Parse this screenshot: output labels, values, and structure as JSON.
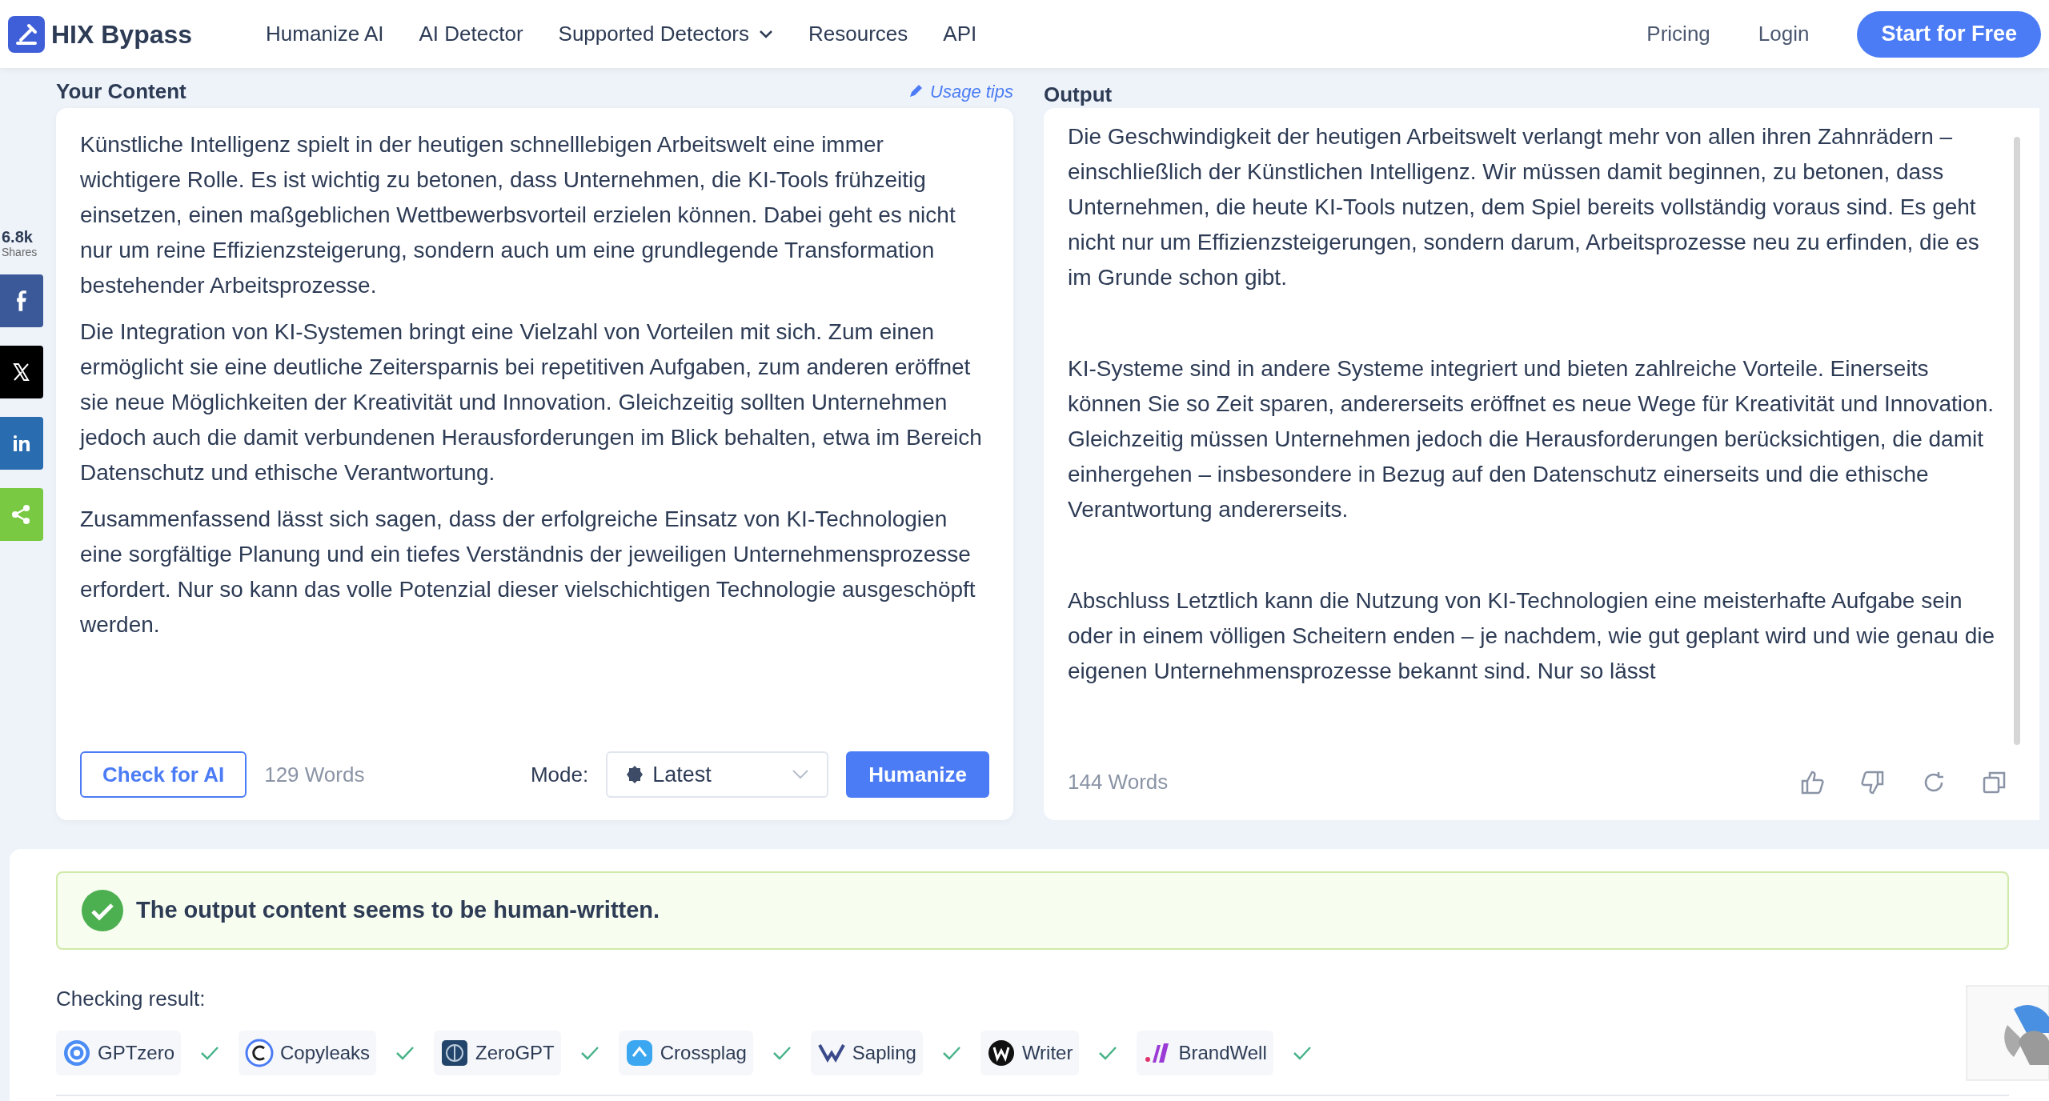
{
  "nav": {
    "logo": "HIX Bypass",
    "links": [
      {
        "label": "Humanize AI",
        "dropdown": false
      },
      {
        "label": "AI Detector",
        "dropdown": false
      },
      {
        "label": "Supported Detectors",
        "dropdown": true
      },
      {
        "label": "Resources",
        "dropdown": false
      },
      {
        "label": "API",
        "dropdown": false
      }
    ],
    "right_links": [
      "Pricing",
      "Login"
    ],
    "cta": "Start for Free"
  },
  "share": {
    "count": "6.8k",
    "label": "Shares",
    "buttons": [
      {
        "kind": "facebook",
        "color": "#3b5998"
      },
      {
        "kind": "x",
        "color": "#000000"
      },
      {
        "kind": "linkedin",
        "color": "#2a6cb0"
      },
      {
        "kind": "share",
        "color": "#7ac943"
      }
    ]
  },
  "input": {
    "title": "Your Content",
    "tips": "Usage tips",
    "paragraphs": [
      "Künstliche Intelligenz spielt in der heutigen schnelllebigen Arbeitswelt eine immer wichtigere Rolle. Es ist wichtig zu betonen, dass Unternehmen, die KI-Tools frühzeitig einsetzen, einen maßgeblichen Wettbewerbsvorteil erzielen können. Dabei geht es nicht nur um reine Effizienzsteigerung, sondern auch um eine grundlegende Transformation bestehender Arbeitsprozesse.",
      "Die Integration von KI-Systemen bringt eine Vielzahl von Vorteilen mit sich. Zum einen ermöglicht sie eine deutliche Zeitersparnis bei repetitiven Aufgaben, zum anderen eröffnet sie neue Möglichkeiten der Kreativität und Innovation. Gleichzeitig sollten Unternehmen jedoch auch die damit verbundenen Herausforderungen im Blick behalten, etwa im Bereich Datenschutz und ethische Verantwortung.",
      "Zusammenfassend lässt sich sagen, dass der erfolgreiche Einsatz von KI-Technologien eine sorgfältige Planung und ein tiefes Verständnis der jeweiligen Unternehmensprozesse erfordert. Nur so kann das volle Potenzial dieser vielschichtigen Technologie ausgeschöpft werden."
    ],
    "check_button": "Check for AI",
    "word_count": "129 Words",
    "mode_label": "Mode:",
    "mode_value": "Latest",
    "humanize_button": "Humanize"
  },
  "output": {
    "title": "Output",
    "paragraphs": [
      "Die Geschwindigkeit der heutigen Arbeitswelt verlangt mehr von allen ihren Zahnrädern – einschließlich der Künstlichen Intelligenz. Wir müssen damit beginnen, zu betonen, dass Unternehmen, die heute KI-Tools nutzen, dem Spiel bereits vollständig voraus sind. Es geht nicht nur um Effizienzsteigerungen, sondern darum, Arbeitsprozesse neu zu erfinden, die es im Grunde schon gibt.",
      "KI-Systeme sind in andere Systeme integriert und bieten zahlreiche Vorteile. Einerseits können Sie so Zeit sparen, andererseits eröffnet es neue Wege für Kreativität und Innovation. Gleichzeitig müssen Unternehmen jedoch die Herausforderungen berücksichtigen, die damit einhergehen – insbesondere in Bezug auf den Datenschutz einerseits und die ethische Verantwortung andererseits.",
      "Abschluss Letztlich kann die Nutzung von KI-Technologien eine meisterhafte Aufgabe sein oder in einem völligen Scheitern enden – je nachdem, wie gut geplant wird und wie genau die eigenen Unternehmensprozesse bekannt sind. Nur so lässt"
    ],
    "word_count": "144 Words"
  },
  "result": {
    "message": "The output content seems to be human-written.",
    "heading": "Checking result:",
    "detectors": [
      {
        "name": "GPTzero",
        "passed": true
      },
      {
        "name": "Copyleaks",
        "passed": true
      },
      {
        "name": "ZeroGPT",
        "passed": true
      },
      {
        "name": "Crossplag",
        "passed": true
      },
      {
        "name": "Sapling",
        "passed": true
      },
      {
        "name": "Writer",
        "passed": true
      },
      {
        "name": "BrandWell",
        "passed": true
      }
    ]
  }
}
